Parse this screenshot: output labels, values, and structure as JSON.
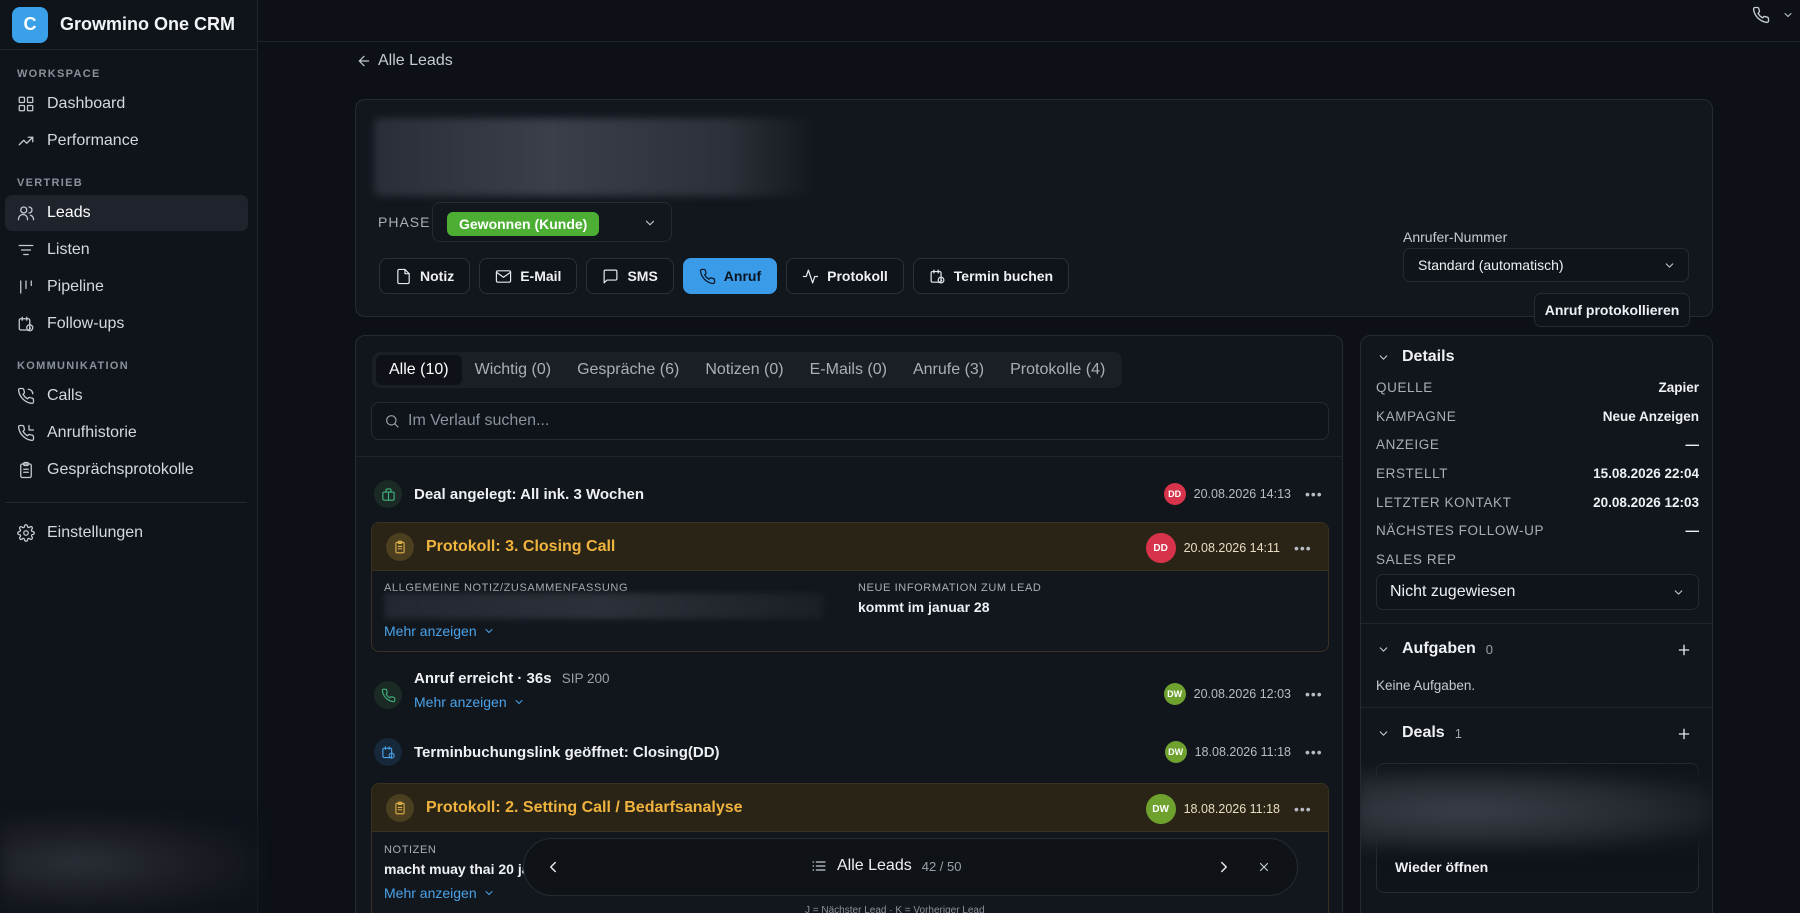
{
  "app": {
    "logo_letter": "C",
    "name": "Growmino One CRM"
  },
  "sidebar": {
    "sections": [
      {
        "label": "WORKSPACE",
        "items": [
          {
            "label": "Dashboard",
            "icon": "grid-icon"
          },
          {
            "label": "Performance",
            "icon": "trending-icon"
          }
        ]
      },
      {
        "label": "VERTRIEB",
        "items": [
          {
            "label": "Leads",
            "icon": "users-icon",
            "active": true
          },
          {
            "label": "Listen",
            "icon": "list-filter-icon"
          },
          {
            "label": "Pipeline",
            "icon": "pipeline-icon"
          },
          {
            "label": "Follow-ups",
            "icon": "calendar-clock-icon"
          }
        ]
      },
      {
        "label": "KOMMUNIKATION",
        "items": [
          {
            "label": "Calls",
            "icon": "phone-icon"
          },
          {
            "label": "Anrufhistorie",
            "icon": "phone-history-icon"
          },
          {
            "label": "Gesprächsprotokolle",
            "icon": "clipboard-icon"
          }
        ]
      }
    ],
    "settings_label": "Einstellungen"
  },
  "back_link": "Alle Leads",
  "lead": {
    "phase_label": "PHASE",
    "phase_value": "Gewonnen (Kunde)",
    "phase_color": "#4caf34",
    "actions": [
      "Notiz",
      "E-Mail",
      "SMS",
      "Anruf",
      "Protokoll",
      "Termin buchen"
    ],
    "caller_label": "Anrufer-Nummer",
    "caller_value": "Standard (automatisch)",
    "log_call_button": "Anruf protokollieren"
  },
  "timeline": {
    "tabs": [
      {
        "label": "Alle",
        "count": "(10)",
        "active": true
      },
      {
        "label": "Wichtig",
        "count": "(0)"
      },
      {
        "label": "Gespräche",
        "count": "(6)"
      },
      {
        "label": "Notizen",
        "count": "(0)"
      },
      {
        "label": "E-Mails",
        "count": "(0)"
      },
      {
        "label": "Anrufe",
        "count": "(3)"
      },
      {
        "label": "Protokolle",
        "count": "(4)"
      }
    ],
    "search_placeholder": "Im Verlauf suchen...",
    "events": {
      "deal": {
        "title": "Deal angelegt: All ink. 3 Wochen",
        "avatar": "DD",
        "time": "20.08.2026 14:13"
      },
      "proto3": {
        "title": "Protokoll: 3. Closing Call",
        "avatar": "DD",
        "time": "20.08.2026 14:11",
        "field1_label": "ALLGEMEINE NOTIZ/ZUSAMMENFASSUNG",
        "field2_label": "NEUE INFORMATION ZUM LEAD",
        "field2_value": "kommt im januar 28",
        "more": "Mehr anzeigen"
      },
      "call": {
        "title": "Anruf erreicht · 36s",
        "sip": "SIP 200",
        "more": "Mehr anzeigen",
        "avatar": "DW",
        "time": "20.08.2026 12:03"
      },
      "booking": {
        "title": "Terminbuchungslink geöffnet: Closing(DD)",
        "avatar": "DW",
        "time": "18.08.2026 11:18"
      },
      "proto2": {
        "title": "Protokoll: 2. Setting Call / Bedarfsanalyse",
        "avatar": "DW",
        "time": "18.08.2026 11:18",
        "field1_label": "NOTIZEN",
        "field1_value": "macht muay thai 20 ja",
        "more": "Mehr anzeigen"
      }
    }
  },
  "navigator": {
    "label": "Alle Leads",
    "count": "42 / 50",
    "hint": "J = Nächster Lead · K = Vorheriger Lead"
  },
  "details": {
    "title": "Details",
    "rows": [
      {
        "key": "QUELLE",
        "value": "Zapier"
      },
      {
        "key": "KAMPAGNE",
        "value": "Neue Anzeigen"
      },
      {
        "key": "ANZEIGE",
        "value": "—"
      },
      {
        "key": "ERSTELLT",
        "value": "15.08.2026 22:04"
      },
      {
        "key": "LETZTER KONTAKT",
        "value": "20.08.2026 12:03"
      },
      {
        "key": "NÄCHSTES FOLLOW-UP",
        "value": "—"
      },
      {
        "key": "SALES REP",
        "value": ""
      }
    ],
    "sales_rep_value": "Nicht zugewiesen",
    "tasks_title": "Aufgaben",
    "tasks_count": "0",
    "tasks_empty": "Keine Aufgaben.",
    "deals_title": "Deals",
    "deals_count": "1",
    "reopen_label": "Wieder öffnen"
  }
}
